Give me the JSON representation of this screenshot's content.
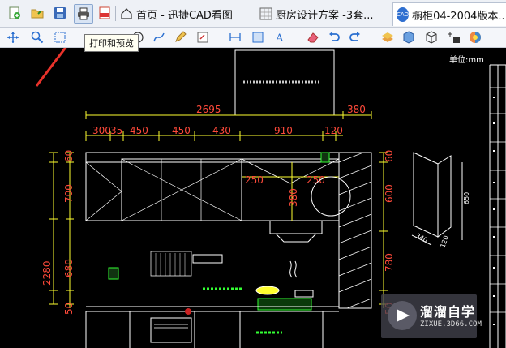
{
  "tabs": [
    {
      "label": "首页 - 迅捷CAD看图"
    },
    {
      "label": "厨房设计方案 -3套..."
    },
    {
      "label": "橱柜04-2004版本..."
    }
  ],
  "tooltip": "打印和预览",
  "drawing": {
    "unit_label": "单位:mm",
    "top_dims": [
      "2695",
      "380"
    ],
    "segment_dims": [
      "300",
      "35",
      "450",
      "450",
      "430",
      "910",
      "120"
    ],
    "left_dims": [
      "60",
      "700",
      "680",
      "50",
      "2280"
    ],
    "right_dims": [
      "60",
      "600",
      "780",
      "50"
    ],
    "inner_dims": [
      "250",
      "380",
      "250"
    ],
    "side_dims": [
      "650",
      "340",
      "120"
    ]
  },
  "watermark": {
    "title": "溜溜自学",
    "url": "ZIXUE.3D66.COM"
  },
  "colors": {
    "dim_red": "#ff4a3a",
    "line_yellow": "#ffff30",
    "line_white": "#ffffff",
    "green": "#33ff33"
  }
}
